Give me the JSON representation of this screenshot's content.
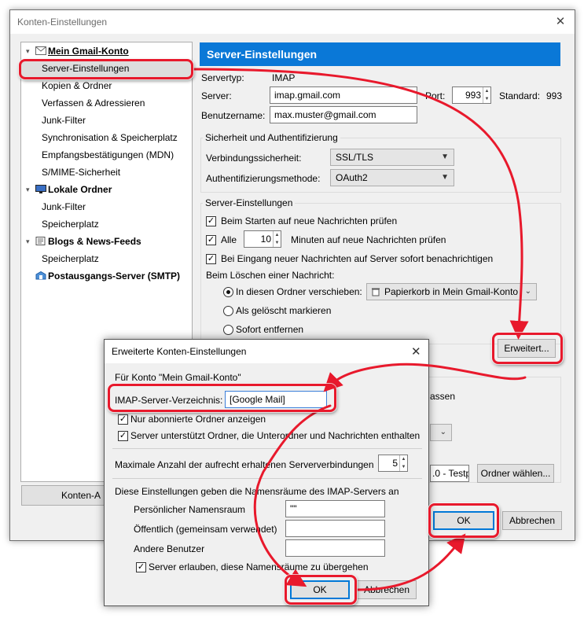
{
  "main_window": {
    "title": "Konten-Einstellungen",
    "close_glyph": "✕",
    "sidebar": [
      {
        "label": "Mein Gmail-Konto",
        "type": "account"
      },
      {
        "label": "Server-Einstellungen",
        "type": "child"
      },
      {
        "label": "Kopien & Ordner",
        "type": "child"
      },
      {
        "label": "Verfassen & Adressieren",
        "type": "child"
      },
      {
        "label": "Junk-Filter",
        "type": "child"
      },
      {
        "label": "Synchronisation & Speicherplatz",
        "type": "child"
      },
      {
        "label": "Empfangsbestätigungen (MDN)",
        "type": "child"
      },
      {
        "label": "S/MIME-Sicherheit",
        "type": "child"
      },
      {
        "label": "Lokale Ordner",
        "type": "account"
      },
      {
        "label": "Junk-Filter",
        "type": "child"
      },
      {
        "label": "Speicherplatz",
        "type": "child"
      },
      {
        "label": "Blogs & News-Feeds",
        "type": "account"
      },
      {
        "label": "Speicherplatz",
        "type": "child"
      },
      {
        "label": "Postausgangs-Server (SMTP)",
        "type": "account"
      }
    ],
    "konten_button": "Konten-A",
    "header": "Server-Einstellungen",
    "servertyp_label": "Servertyp:",
    "servertyp_value": "IMAP",
    "server_label": "Server:",
    "server_value": "imap.gmail.com",
    "port_label": "Port:",
    "port_value": "993",
    "standard_label": "Standard:",
    "standard_value": "993",
    "benutzername_label": "Benutzername:",
    "benutzername_value": "max.muster@gmail.com",
    "security_group": "Sicherheit und Authentifizierung",
    "verbindung_label": "Verbindungssicherheit:",
    "verbindung_value": "SSL/TLS",
    "auth_label": "Authentifizierungsmethode:",
    "auth_value": "OAuth2",
    "server_group": "Server-Einstellungen",
    "cb_start": "Beim Starten auf neue Nachrichten prüfen",
    "cb_alle": "Alle",
    "minutes_value": "10",
    "minutes_text": "Minuten auf neue Nachrichten prüfen",
    "cb_eingang": "Bei Eingang neuer Nachrichten auf Server sofort benachrichtigen",
    "delete_label": "Beim Löschen einer Nachricht:",
    "radio_move": "In diesen Ordner verschieben:",
    "trash_folder": "Papierkorb in Mein Gmail-Konto",
    "radio_mark": "Als gelöscht markieren",
    "radio_remove": "Sofort entfernen",
    "erweitert_button": "Erweitert...",
    "partial_assen": "assen",
    "partial_testp": ".0 - Testp",
    "ordner_button": "Ordner wählen...",
    "ok_button": "OK",
    "abbrechen_button": "Abbrechen"
  },
  "dialog": {
    "title": "Erweiterte Konten-Einstellungen",
    "close_glyph": "✕",
    "account_line": "Für Konto \"Mein Gmail-Konto\"",
    "imap_dir_label": "IMAP-Server-Verzeichnis:",
    "imap_dir_value": "[Google Mail]",
    "cb_subscribed": "Nur abonnierte Ordner anzeigen",
    "cb_folders": "Server unterstützt Ordner, die Unterordner und Nachrichten enthalten",
    "max_conn_label": "Maximale Anzahl der aufrecht erhaltenen Serververbindungen",
    "max_conn_value": "5",
    "namespace_intro": "Diese Einstellungen geben die Namensräume des IMAP-Servers an",
    "personal_label": "Persönlicher Namensraum",
    "personal_value": "\"\"",
    "public_label": "Öffentlich (gemeinsam verwendet)",
    "others_label": "Andere Benutzer",
    "cb_allow": "Server erlauben, diese Namensräume zu übergehen",
    "ok_button": "OK",
    "abbrechen_button": "Abbrechen"
  },
  "annotation_color": "#e8192c",
  "accent_color": "#0a78d7"
}
